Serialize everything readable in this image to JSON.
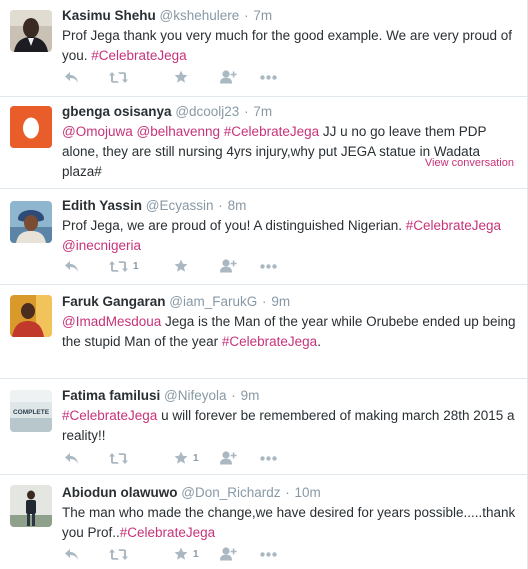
{
  "tweets": [
    {
      "name": "Kasimu Shehu",
      "handle": "@kshehulere",
      "time": "7m",
      "segments": [
        {
          "t": "text",
          "v": "Prof Jega thank you very much for the good example.  We are very proud of you. "
        },
        {
          "t": "hashtag",
          "v": "#CelebrateJega"
        }
      ],
      "retweets": "",
      "favorites": "",
      "avatar": "man-dark-suit",
      "view_conversation": ""
    },
    {
      "name": "gbenga osisanya",
      "handle": "@dcoolj23",
      "time": "7m",
      "segments": [
        {
          "t": "mention",
          "v": "@Omojuwa"
        },
        {
          "t": "text",
          "v": " "
        },
        {
          "t": "mention",
          "v": "@belhavenng"
        },
        {
          "t": "text",
          "v": " "
        },
        {
          "t": "hashtag",
          "v": "#CelebrateJega"
        },
        {
          "t": "text",
          "v": " JJ u no go leave them PDP alone, they are still nursing 4yrs injury,why put JEGA statue in Wadata plaza#"
        }
      ],
      "retweets": "",
      "favorites": "",
      "avatar": "default-egg",
      "view_conversation": "View conversation"
    },
    {
      "name": "Edith Yassin",
      "handle": "@Ecyassin",
      "time": "8m",
      "segments": [
        {
          "t": "text",
          "v": "Prof Jega, we are proud of you! A distinguished Nigerian. "
        },
        {
          "t": "hashtag",
          "v": "#CelebrateJega"
        },
        {
          "t": "text",
          "v": " "
        },
        {
          "t": "mention",
          "v": "@inecnigeria"
        }
      ],
      "retweets": "1",
      "favorites": "",
      "avatar": "woman-headwrap",
      "view_conversation": ""
    },
    {
      "name": "Faruk Gangaran",
      "handle": "@iam_FarukG",
      "time": "9m",
      "segments": [
        {
          "t": "mention",
          "v": "@ImadMesdoua"
        },
        {
          "t": "text",
          "v": "  Jega is the Man of the year while Orubebe ended up being the stupid Man of the year "
        },
        {
          "t": "hashtag",
          "v": "#CelebrateJega"
        },
        {
          "t": "text",
          "v": "."
        }
      ],
      "retweets": "",
      "favorites": "",
      "avatar": "man-red-shirt",
      "view_conversation": ""
    },
    {
      "name": "Fatima familusi",
      "handle": "@Nifeyola",
      "time": "9m",
      "segments": [
        {
          "t": "hashtag",
          "v": "#CelebrateJega"
        },
        {
          "t": "text",
          "v": " u will forever be remembered of making march 28th  2015 a reality!!"
        }
      ],
      "retweets": "",
      "favorites": "1",
      "avatar": "book-cover",
      "avatar_text": [
        "COMPLETE"
      ],
      "view_conversation": ""
    },
    {
      "name": "Abiodun olawuwo",
      "handle": "@Don_Richardz",
      "time": "10m",
      "segments": [
        {
          "t": "text",
          "v": "The man who made the change,we have desired for years possible.....thank you Prof.."
        },
        {
          "t": "hashtag",
          "v": "#CelebrateJega"
        }
      ],
      "retweets": "",
      "favorites": "1",
      "avatar": "man-standing-green",
      "view_conversation": ""
    }
  ],
  "icons": {
    "reply": "reply-icon",
    "retweet": "retweet-icon",
    "favorite": "star-icon",
    "follow": "follow-icon",
    "more": "more-icon"
  },
  "colors": {
    "link": "#c7337a",
    "muted": "#8899a6",
    "icon": "#aab8c2",
    "divider": "#e1e8ed",
    "egg_bg": "#e95d2b"
  }
}
